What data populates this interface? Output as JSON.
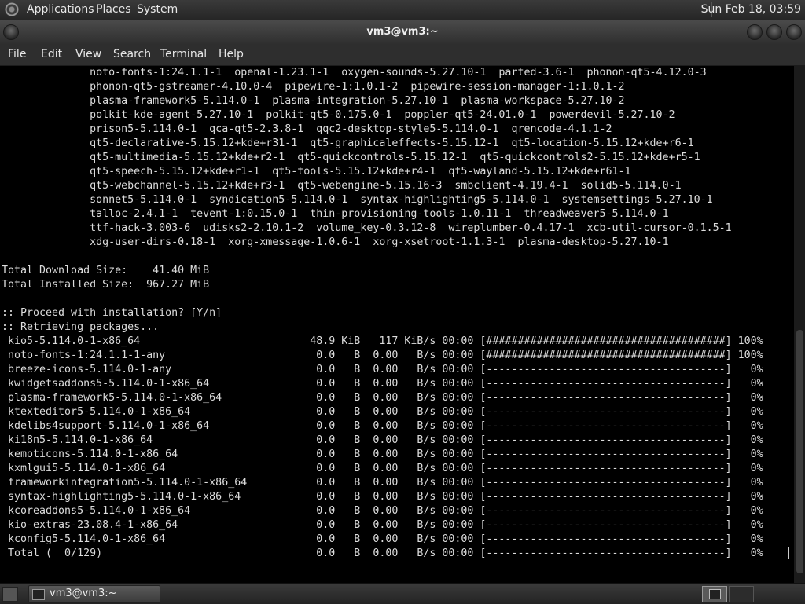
{
  "top_panel": {
    "menus": [
      "Applications",
      "Places",
      "System"
    ],
    "clock": "Sun Feb 18, 03:59",
    "logo_icon": "distro-logo-icon"
  },
  "window": {
    "title": "vm3@vm3:~",
    "menus": [
      "File",
      "Edit",
      "View",
      "Search",
      "Terminal",
      "Help"
    ]
  },
  "terminal": {
    "lines": [
      "              noto-fonts-1:24.1.1-1  openal-1.23.1-1  oxygen-sounds-5.27.10-1  parted-3.6-1  phonon-qt5-4.12.0-3",
      "              phonon-qt5-gstreamer-4.10.0-4  pipewire-1:1.0.1-2  pipewire-session-manager-1:1.0.1-2",
      "              plasma-framework5-5.114.0-1  plasma-integration-5.27.10-1  plasma-workspace-5.27.10-2",
      "              polkit-kde-agent-5.27.10-1  polkit-qt5-0.175.0-1  poppler-qt5-24.01.0-1  powerdevil-5.27.10-2",
      "              prison5-5.114.0-1  qca-qt5-2.3.8-1  qqc2-desktop-style5-5.114.0-1  qrencode-4.1.1-2",
      "              qt5-declarative-5.15.12+kde+r31-1  qt5-graphicaleffects-5.15.12-1  qt5-location-5.15.12+kde+r6-1",
      "              qt5-multimedia-5.15.12+kde+r2-1  qt5-quickcontrols-5.15.12-1  qt5-quickcontrols2-5.15.12+kde+r5-1",
      "              qt5-speech-5.15.12+kde+r1-1  qt5-tools-5.15.12+kde+r4-1  qt5-wayland-5.15.12+kde+r61-1",
      "              qt5-webchannel-5.15.12+kde+r3-1  qt5-webengine-5.15.16-3  smbclient-4.19.4-1  solid5-5.114.0-1",
      "              sonnet5-5.114.0-1  syndication5-5.114.0-1  syntax-highlighting5-5.114.0-1  systemsettings-5.27.10-1",
      "              talloc-2.4.1-1  tevent-1:0.15.0-1  thin-provisioning-tools-1.0.11-1  threadweaver5-5.114.0-1",
      "              ttf-hack-3.003-6  udisks2-2.10.1-2  volume_key-0.3.12-8  wireplumber-0.4.17-1  xcb-util-cursor-0.1.5-1",
      "              xdg-user-dirs-0.18-1  xorg-xmessage-1.0.6-1  xorg-xsetroot-1.1.3-1  plasma-desktop-5.27.10-1",
      "",
      "Total Download Size:    41.40 MiB",
      "Total Installed Size:  967.27 MiB",
      "",
      ":: Proceed with installation? [Y/n]",
      ":: Retrieving packages...",
      " kio5-5.114.0-1-x86_64                           48.9 KiB   117 KiB/s 00:00 [######################################] 100%",
      " noto-fonts-1:24.1.1-1-any                        0.0   B  0.00   B/s 00:00 [######################################] 100%",
      " breeze-icons-5.114.0-1-any                       0.0   B  0.00   B/s 00:00 [--------------------------------------]   0%",
      " kwidgetsaddons5-5.114.0-1-x86_64                 0.0   B  0.00   B/s 00:00 [--------------------------------------]   0%",
      " plasma-framework5-5.114.0-1-x86_64               0.0   B  0.00   B/s 00:00 [--------------------------------------]   0%",
      " ktexteditor5-5.114.0-1-x86_64                    0.0   B  0.00   B/s 00:00 [--------------------------------------]   0%",
      " kdelibs4support-5.114.0-1-x86_64                 0.0   B  0.00   B/s 00:00 [--------------------------------------]   0%",
      " ki18n5-5.114.0-1-x86_64                          0.0   B  0.00   B/s 00:00 [--------------------------------------]   0%",
      " kemoticons-5.114.0-1-x86_64                      0.0   B  0.00   B/s 00:00 [--------------------------------------]   0%",
      " kxmlgui5-5.114.0-1-x86_64                        0.0   B  0.00   B/s 00:00 [--------------------------------------]   0%",
      " frameworkintegration5-5.114.0-1-x86_64           0.0   B  0.00   B/s 00:00 [--------------------------------------]   0%",
      " syntax-highlighting5-5.114.0-1-x86_64            0.0   B  0.00   B/s 00:00 [--------------------------------------]   0%",
      " kcoreaddons5-5.114.0-1-x86_64                    0.0   B  0.00   B/s 00:00 [--------------------------------------]   0%",
      " kio-extras-23.08.4-1-x86_64                      0.0   B  0.00   B/s 00:00 [--------------------------------------]   0%",
      " kconfig5-5.114.0-1-x86_64                        0.0   B  0.00   B/s 00:00 [--------------------------------------]   0%",
      " Total (  0/129)                                  0.0   B  0.00   B/s 00:00 [--------------------------------------]   0%"
    ]
  },
  "taskbar": {
    "task_label": "vm3@vm3:~"
  }
}
